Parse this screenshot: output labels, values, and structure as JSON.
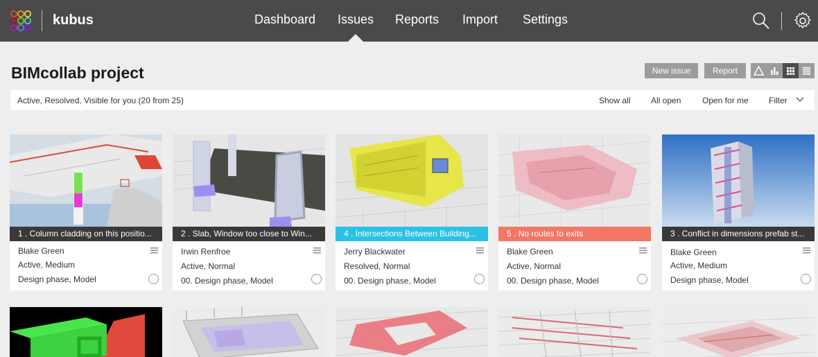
{
  "app": {
    "brand": "kubus",
    "nav": [
      "Dashboard",
      "Issues",
      "Reports",
      "Import",
      "Settings"
    ],
    "active_nav": "Issues",
    "icons": [
      "logo-icon",
      "search-icon",
      "gear-icon"
    ]
  },
  "project": {
    "title": "BIMcollab project",
    "buttons": {
      "new_issue": "New issue",
      "report": "Report"
    },
    "view_icons": [
      "triangle-icon",
      "bar-chart-icon",
      "grid-view-icon",
      "list-view-icon"
    ],
    "active_view": "grid-view-icon"
  },
  "filter": {
    "summary": "Active, Resolved, Visible for you (20 from 25)",
    "options": [
      "Show all",
      "All open",
      "Open for me",
      "Filter"
    ]
  },
  "colors": {
    "topbar": "#4a4a4a",
    "background": "#eeeeee",
    "caption_dark": "#282828",
    "caption_cyan": "#2bc1e6",
    "caption_salmon": "#f47664"
  },
  "issues": [
    {
      "title": "1 . Column cladding on this positio...",
      "assignee": "Blake Green",
      "status": "Active, Medium",
      "phase": "Design phase, Model",
      "caption_color": "#282828"
    },
    {
      "title": "2 . Slab, Window too close to Win...",
      "assignee": "Irwin Renfroe",
      "status": "Active, Normal",
      "phase": "00. Design phase, Model",
      "caption_color": "#282828"
    },
    {
      "title": "4 . Intersections Between Building...",
      "assignee": "Jerry Blackwater",
      "status": "Resolved, Normal",
      "phase": "00. Design phase, Model",
      "caption_color": "#2bc1e6"
    },
    {
      "title": "5 . No routes to exits",
      "assignee": "Blake Green",
      "status": "Active, Normal",
      "phase": "00. Design phase, Model",
      "caption_color": "#f47664"
    },
    {
      "title": "3 . Conflict in dimensions prefab st...",
      "assignee": "Blake Green",
      "status": "Active, Medium",
      "phase": "Design phase, Model",
      "caption_color": "#282828"
    }
  ]
}
